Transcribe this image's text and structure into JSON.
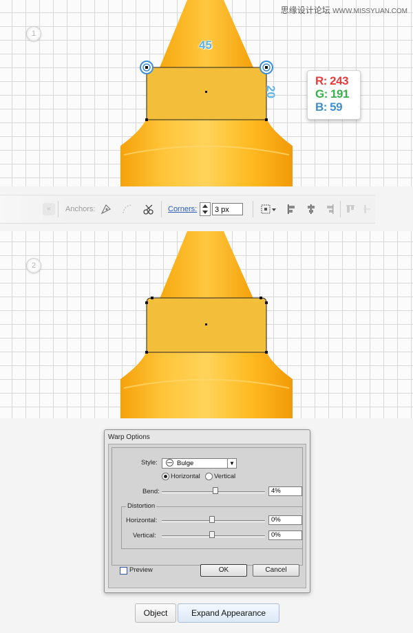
{
  "watermark": {
    "text": "思缘设计论坛",
    "url": "WWW.MISSYUAN.COM"
  },
  "step1": {
    "number": "1",
    "dim_width": "45",
    "dim_height": "20",
    "rgb": {
      "r": "R: 243",
      "g": "G: 191",
      "b": "B: 59"
    }
  },
  "toolbar": {
    "anchors_label": "Anchors:",
    "corners_label": "Corners:",
    "corners_value": "3 px"
  },
  "step2": {
    "number": "2"
  },
  "warp": {
    "title": "Warp Options",
    "style_label": "Style:",
    "style_value": "Bulge",
    "orientation": {
      "horizontal": "Horizontal",
      "vertical": "Vertical",
      "selected": "horizontal"
    },
    "bend_label": "Bend:",
    "bend_value": "4%",
    "bend_level": 0.52,
    "distortion_title": "Distortion",
    "dist_horizontal_label": "Horizontal:",
    "dist_horizontal_value": "0%",
    "dist_vertical_label": "Vertical:",
    "dist_vertical_value": "0%",
    "preview_label": "Preview",
    "ok_label": "OK",
    "cancel_label": "Cancel"
  },
  "bottom_bar": {
    "object_label": "Object",
    "expand_label": "Expand Appearance"
  },
  "colors": {
    "fill": "#f3bf3b",
    "bottle": "#ffb51a",
    "handle": "#3b8fd8"
  }
}
